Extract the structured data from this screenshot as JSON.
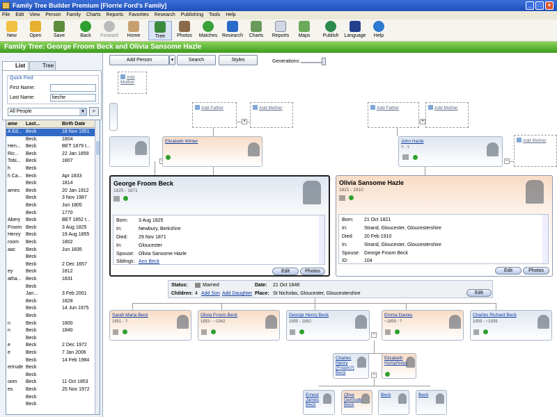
{
  "window": {
    "title": "Family Tree Builder Premium [Florrie Ford's Family]"
  },
  "menu": [
    "File",
    "Edit",
    "View",
    "Person",
    "Family",
    "Charts",
    "Reports",
    "Favorites",
    "Research",
    "Publishing",
    "Tools",
    "Help"
  ],
  "toolbar": [
    "New",
    "Open",
    "Save",
    "Back",
    "Forward",
    "Home",
    "Tree",
    "Photos",
    "Matches",
    "Research",
    "Charts",
    "Reports",
    "Maps",
    "Publish",
    "Language",
    "Help"
  ],
  "banner": "Family Tree: George Froom Beck and Olivia Sansome Hazle",
  "left": {
    "tabs": [
      "List",
      "Tree"
    ],
    "quickfind": "Quick Find",
    "first_name_label": "First Name:",
    "last_name_label": "Last Name:",
    "first_name_value": "",
    "last_name_value": "beche",
    "filter": "All People",
    "columns": [
      "ame",
      "Last...",
      "Birth Date"
    ],
    "rows": [
      [
        "A Ed...",
        "Beck",
        "18 Nov 1951"
      ],
      [
        "",
        "Beck",
        "1804"
      ],
      [
        "Hen...",
        "Beck",
        "BET 1879 t..."
      ],
      [
        "Ric...",
        "Beck",
        "22 Jan 1859"
      ],
      [
        "Tobi...",
        "Beck",
        "1807"
      ],
      [
        "h",
        "Beck",
        ""
      ],
      [
        "h Ca...",
        "Beck",
        "Apr 1833"
      ],
      [
        "",
        "Beck",
        "1814"
      ],
      [
        "ames",
        "Beck",
        "20 Jan 1912"
      ],
      [
        "",
        "Beck",
        "3 Nov 1987"
      ],
      [
        "",
        "Beck",
        "Jun 1805"
      ],
      [
        "",
        "Beck",
        "1770"
      ],
      [
        "Abery",
        "Beck",
        "BET 1852 t..."
      ],
      [
        "Froom",
        "Beck",
        "3 Aug 1825"
      ],
      [
        "Henry",
        "Beck",
        "19 Aug 1855"
      ],
      [
        "room",
        "Beck",
        "1802"
      ],
      [
        "aac",
        "Beck",
        "Jun 1835"
      ],
      [
        "",
        "Beck",
        ""
      ],
      [
        "",
        "Beck",
        "2 Dec 1657"
      ],
      [
        "ey",
        "Beck",
        "1812"
      ],
      [
        "atha...",
        "Beck",
        "1831"
      ],
      [
        "",
        "Beck",
        ""
      ],
      [
        "",
        "Jan...",
        "3 Feb 2001"
      ],
      [
        "",
        "Beck",
        "1828"
      ],
      [
        "",
        "Beck",
        "14 Jun 1975"
      ],
      [
        "",
        "Beck",
        ""
      ],
      [
        "n",
        "Beck",
        "1800"
      ],
      [
        "n",
        "Beck",
        "1840"
      ],
      [
        "",
        "Beck",
        ""
      ],
      [
        "e",
        "Beck",
        "2 Dec 1972"
      ],
      [
        "e",
        "Beck",
        "7 Jan 2006"
      ],
      [
        "",
        "Beck",
        "14 Feb 1984"
      ],
      [
        "ertrude",
        "Beck",
        ""
      ],
      [
        "",
        "Beck",
        ""
      ],
      [
        "oom",
        "Beck",
        "11 Oct 1853"
      ],
      [
        "es",
        "Beck",
        "25 Nov 1972"
      ],
      [
        "",
        "Beck",
        ""
      ],
      [
        "",
        "Beck",
        ""
      ]
    ]
  },
  "controls": {
    "add_person": "Add Person",
    "search": "Search",
    "styles": "Styles",
    "generations": "Generations:"
  },
  "tree": {
    "add_mother": "Add Mother",
    "add_father": "Add Father",
    "elizabeth": {
      "name": "Elizabeth Winter"
    },
    "john": {
      "name": "John Hazle",
      "years": "? - ?"
    },
    "husband": {
      "name": "George Froom Beck",
      "years": "1825 - 1871",
      "born_k": "Born:",
      "born": "3 Aug 1825",
      "in_k": "In:",
      "born_in": "Newbury, Berkshire",
      "died_k": "Died:",
      "died": "29 Nov 1871",
      "died_in": "Gloucester",
      "spouse_k": "Spouse:",
      "spouse": "Olivia Sansome Hazle",
      "siblings_k": "Siblings:",
      "siblings": "Ann Beck"
    },
    "wife": {
      "name": "Olivia Sansome Hazle",
      "years": "1821 - 1910",
      "born": "21 Oct 1821",
      "born_in": "Strand, Gloucester, Gloucestershire",
      "died": "20 Feb 1910",
      "died_in": "Strand, Gloucester, Gloucestershire",
      "spouse": "George Froom Beck",
      "id_k": "ID:",
      "id": "104"
    },
    "edit": "Edit",
    "photos": "Photos",
    "marriage": {
      "status_k": "Status:",
      "status": "Married",
      "date_k": "Date:",
      "date": "21 Oct 1848",
      "children_k": "Children:",
      "children": "4",
      "add_son": "Add Son",
      "add_daughter": "Add Daughter",
      "place_k": "Place:",
      "place": "St Nicholas, Gloucester, Gloucestershire"
    },
    "children": [
      {
        "name": "Sarah Maria Beck",
        "years": "1851 - ?"
      },
      {
        "name": "Olivia Froom Beck",
        "years": "1853 - ~1942"
      },
      {
        "name": "George Henry Beck",
        "years": "1855 - 1882"
      },
      {
        "name": "Emma Davies",
        "years": "~1859 - ?"
      },
      {
        "name": "Charles Richard Beck",
        "years": "1859 - ~1939"
      }
    ],
    "gchild_parents": [
      {
        "name": "Charles Henry (Froom?) Beck"
      },
      {
        "name": "Elizabeth Humphreys"
      }
    ],
    "gchildren": [
      {
        "name": "Ernest James Beck"
      },
      {
        "name": "Olive Gertrude Beck"
      },
      {
        "name": "Beck"
      },
      {
        "name": "Beck"
      }
    ]
  },
  "colors": {
    "banner": "#5ab82e",
    "selection": "#316ac5",
    "male": "#dfe6ef",
    "female": "#f8dcc6"
  }
}
